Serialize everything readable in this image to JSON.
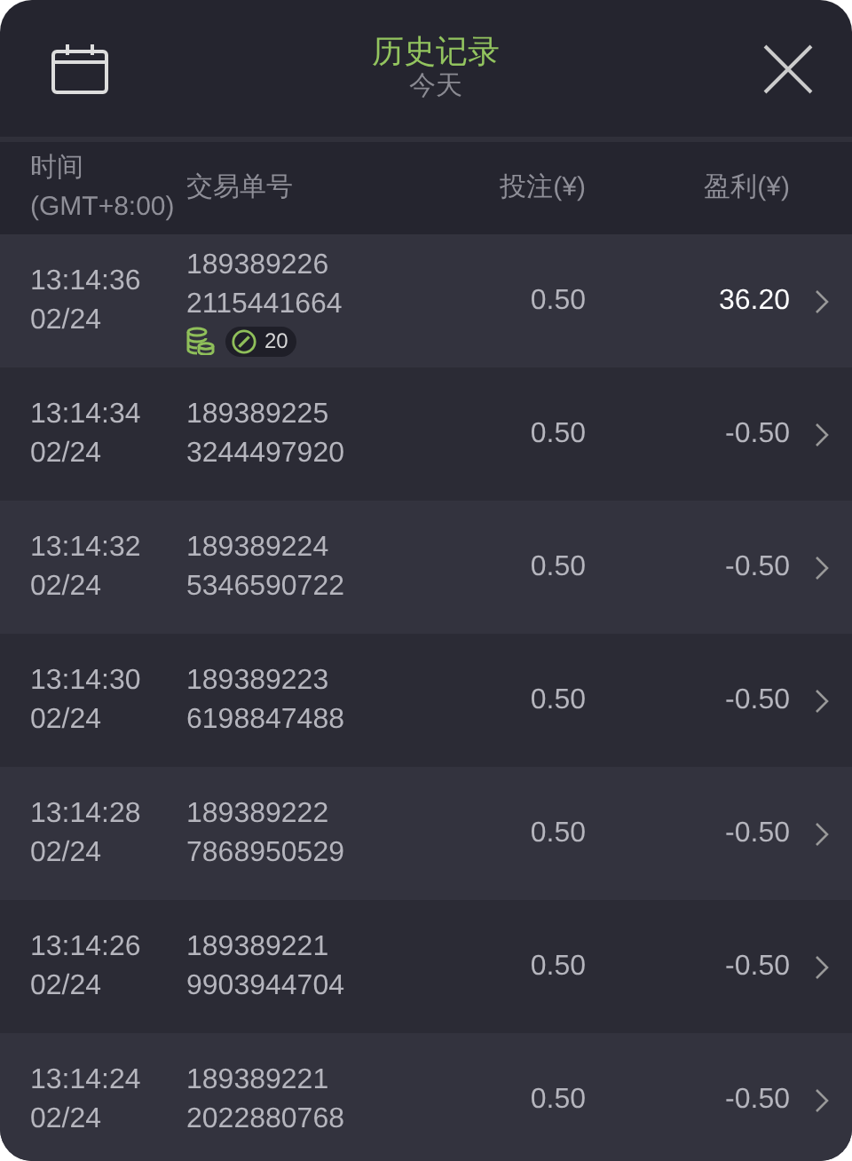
{
  "header": {
    "title": "历史记录",
    "subtitle": "今天"
  },
  "columns": [
    "时间\n(GMT+8:00)",
    "交易单号",
    "投注(¥)",
    "盈利(¥)"
  ],
  "rows": [
    {
      "time": "13:14:36",
      "date": "02/24",
      "id_1": "189389226",
      "id_2": "2115441664",
      "bet": "0.50",
      "profit": "36.20",
      "won": true,
      "spins": "20"
    },
    {
      "time": "13:14:34",
      "date": "02/24",
      "id_1": "189389225",
      "id_2": "3244497920",
      "bet": "0.50",
      "profit": "-0.50",
      "won": false
    },
    {
      "time": "13:14:32",
      "date": "02/24",
      "id_1": "189389224",
      "id_2": "5346590722",
      "bet": "0.50",
      "profit": "-0.50",
      "won": false
    },
    {
      "time": "13:14:30",
      "date": "02/24",
      "id_1": "189389223",
      "id_2": "6198847488",
      "bet": "0.50",
      "profit": "-0.50",
      "won": false
    },
    {
      "time": "13:14:28",
      "date": "02/24",
      "id_1": "189389222",
      "id_2": "7868950529",
      "bet": "0.50",
      "profit": "-0.50",
      "won": false
    },
    {
      "time": "13:14:26",
      "date": "02/24",
      "id_1": "189389221",
      "id_2": "9903944704",
      "bet": "0.50",
      "profit": "-0.50",
      "won": false
    },
    {
      "time": "13:14:24",
      "date": "02/24",
      "id_1": "189389221",
      "id_2": "2022880768",
      "bet": "0.50",
      "profit": "-0.50",
      "won": false
    }
  ]
}
